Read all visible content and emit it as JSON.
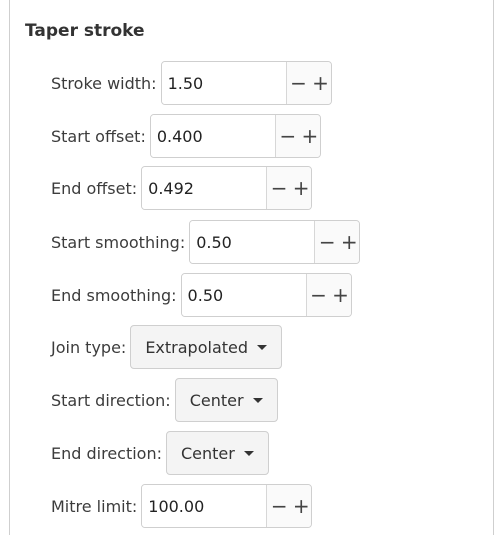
{
  "section": {
    "title": "Taper stroke"
  },
  "controls": {
    "stroke_width": {
      "label": "Stroke width:",
      "value": "1.50",
      "minus": "−",
      "plus": "+"
    },
    "start_offset": {
      "label": "Start offset:",
      "value": "0.400",
      "minus": "−",
      "plus": "+"
    },
    "end_offset": {
      "label": "End offset:",
      "value": "0.492",
      "minus": "−",
      "plus": "+"
    },
    "start_smoothing": {
      "label": "Start smoothing:",
      "value": "0.50",
      "minus": "−",
      "plus": "+"
    },
    "end_smoothing": {
      "label": "End smoothing:",
      "value": "0.50",
      "minus": "−",
      "plus": "+"
    },
    "join_type": {
      "label": "Join type:",
      "selected": "Extrapolated"
    },
    "start_direction": {
      "label": "Start direction:",
      "selected": "Center"
    },
    "end_direction": {
      "label": "End direction:",
      "selected": "Center"
    },
    "mitre_limit": {
      "label": "Mitre limit:",
      "value": "100.00",
      "minus": "−",
      "plus": "+"
    }
  }
}
